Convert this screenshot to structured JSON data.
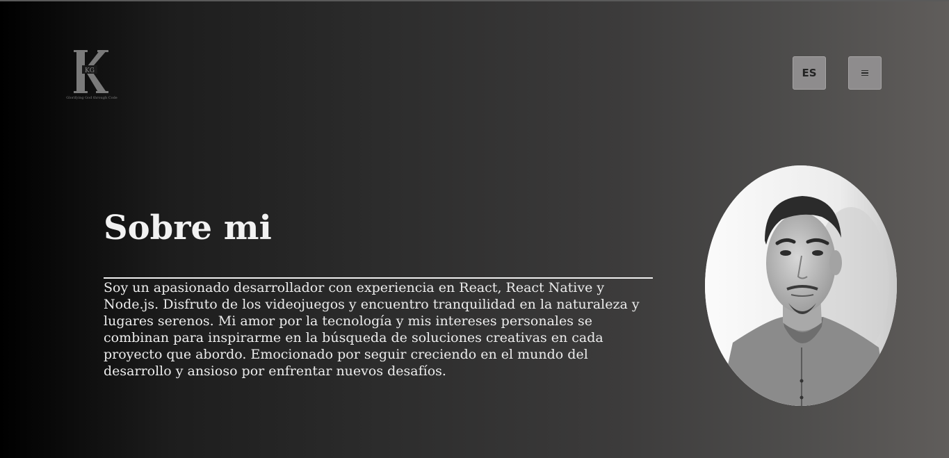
{
  "header": {
    "logo": {
      "letter": "K",
      "initials": "KG",
      "tagline": "Glorifying God through Code"
    },
    "language_button_label": "ES",
    "menu_button_icon": "hamburger-icon"
  },
  "about": {
    "title": "Sobre mi",
    "bio": "Soy un apasionado desarrollador con experiencia en React, React Native y Node.js. Disfruto de los videojuegos y encuentro tranquilidad en la naturaleza y lugares serenos. Mi amor por la tecnología y mis intereses personales se combinan para inspirarme en la búsqueda de soluciones creativas en cada proyecto que abordo. Emocionado por seguir creciendo en el mundo del desarrollo y ansioso por enfrentar nuevos desafíos."
  },
  "profile_photo": {
    "icon": "profile-photo"
  },
  "colors": {
    "text": "#f1f1f1",
    "button_bg": "#8e8c8d",
    "gradient_start": "#000000",
    "gradient_end": "#605d5b"
  }
}
